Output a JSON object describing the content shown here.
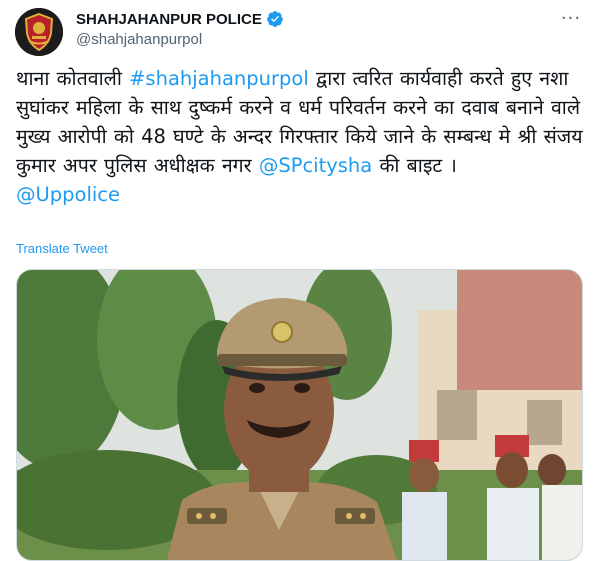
{
  "account": {
    "display_name": "SHAHJAHANPUR POLICE",
    "handle": "@shahjahanpurpol",
    "avatar_icon": "police-emblem-icon",
    "verified_icon": "verified-badge-icon",
    "verified_color": "#1d9bf0"
  },
  "tweet": {
    "text_1": "थाना कोतवाली ",
    "hashtag": "#shahjahanpurpol",
    "text_2": " द्वारा त्वरित कार्यवाही करते हुए नशा सुघांकर महिला के साथ दुष्कर्म करने व धर्म परिवर्तन करने का दवाब बनाने वाले मुख्य आरोपी को 48 घण्टे के अन्दर गिरफ्तार किये जाने के सम्बन्ध मे श्री संजय कुमार अपर पुलिस अधीक्षक नगर ",
    "mention_1": "@SPcitysha",
    "text_3": " की बाइट ।",
    "mention_2": "@Uppolice",
    "link_color": "#1d9bf0"
  },
  "translate_label": "Translate Tweet",
  "more_icon": "more-options-icon"
}
